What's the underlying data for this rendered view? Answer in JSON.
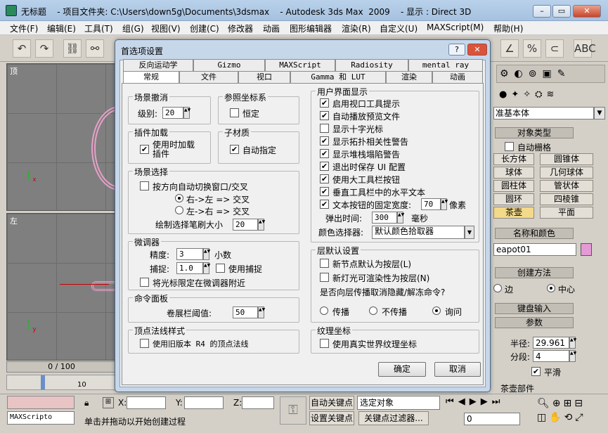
{
  "window": {
    "title": "无标题    - 项目文件夹: C:\\Users\\down5g\\Documents\\3dsmax    - Autodesk 3ds Max  2009    - 显示 : Direct 3D",
    "minimize": "–",
    "maximize": "▭",
    "close": "✕"
  },
  "menubar": [
    "文件(F)",
    "编辑(E)",
    "工具(T)",
    "组(G)",
    "视图(V)",
    "创建(C)",
    "修改器",
    "动画",
    "图形编辑器",
    "渲染(R)",
    "自定义(U)",
    "MAXScript(M)",
    "帮助(H)"
  ],
  "viewports": {
    "top_label": "顶",
    "left_label": "左"
  },
  "timeline": {
    "frame": "0 / 100",
    "tick": "10"
  },
  "right_panel": {
    "dropdown": "准基本体",
    "object_type": "对象类型",
    "auto_grid": "自动栅格",
    "buttons": [
      "长方体",
      "圆锥体",
      "球体",
      "几何球体",
      "圆柱体",
      "管状体",
      "圆环",
      "四棱锥",
      "茶壶",
      "平面"
    ],
    "name_color": "名称和颜色",
    "name_value": "eapot01",
    "creation_method": "创建方法",
    "edge": "边",
    "center": "中心",
    "keyboard_input": "键盘输入",
    "params": "参数",
    "radius_label": "半径:",
    "radius_value": "29.961",
    "segments_label": "分段:",
    "segments_value": "4",
    "smooth": "平滑",
    "more": "茶壶部件"
  },
  "statusbar": {
    "script_box": "MAXScripto",
    "x_label": "X:",
    "y_label": "Y:",
    "z_label": "Z:",
    "prompt": "单击并拖动以开始创建过程",
    "auto_key": "自动关键点",
    "set_key": "设置关键点",
    "select_object": "选定对象",
    "key_filter": "关键点过滤器...",
    "frame_value": "0"
  },
  "dialog": {
    "title": "首选项设置",
    "help_btn": "?",
    "close_btn": "✕",
    "tabs_row1": [
      "反向运动学",
      "Gizmo",
      "MAXScript",
      "Radiosity",
      "mental ray"
    ],
    "tabs_row2": [
      "常规",
      "文件",
      "视口",
      "Gamma 和 LUT",
      "渲染",
      "动画"
    ],
    "scene_undo": {
      "title": "场景撤消",
      "level_label": "级别:",
      "level_value": "20"
    },
    "ref_coord": {
      "title": "参照坐标系",
      "constant": "恒定"
    },
    "plugin_load": {
      "title": "插件加载",
      "load_on_use": "使用时加载插件"
    },
    "sub_material": {
      "title": "子材质",
      "auto_assign": "自动指定"
    },
    "scene_select": {
      "title": "场景选择",
      "auto_switch": "按方向自动切换窗口/交叉",
      "r2l": "右->左 => 交叉",
      "l2r": "左->右 => 交叉",
      "brush_size_label": "绘制选择笔刷大小",
      "brush_size_value": "20"
    },
    "spinners": {
      "title": "微调器",
      "precision_label": "精度:",
      "precision_value": "3",
      "precision_unit": "小数",
      "snap_label": "捕捉:",
      "snap_value": "1.0",
      "use_snap": "使用捕捉",
      "cursor_limit": "将光标限定在微调器附近"
    },
    "command_panel": {
      "title": "命令面板",
      "threshold_label": "卷展栏阈值:",
      "threshold_value": "50"
    },
    "vertex_normal": {
      "title": "顶点法线样式",
      "legacy": "使用旧版本 R4 的顶点法线"
    },
    "ui_display": {
      "title": "用户界面显示",
      "items": [
        "启用视口工具提示",
        "自动播放预览文件",
        "显示十字光标",
        "显示拓扑相关性警告",
        "显示堆栈塌陷警告",
        "退出时保存 UI 配置",
        "使用大工具栏按钮",
        "垂直工具栏中的水平文本",
        "文本按钮的固定宽度:"
      ],
      "width_value": "70",
      "width_unit": "像素",
      "flyout_label": "弹出时间:",
      "flyout_value": "300",
      "flyout_unit": "毫秒",
      "color_picker_label": "颜色选择器:",
      "color_picker_value": "默认颜色拾取器"
    },
    "layer_defaults": {
      "title": "层默认设置",
      "new_node": "新节点默认为按层(L)",
      "new_light": "新灯光可渲染性为按层(N)",
      "question": "是否向层传播取消隐藏/解冻命令?",
      "propagate": "传播",
      "no_propagate": "不传播",
      "ask": "询问"
    },
    "texture_coord": {
      "title": "纹理坐标",
      "real_world": "使用真实世界纹理坐标"
    },
    "ok": "确定",
    "cancel": "取消"
  }
}
